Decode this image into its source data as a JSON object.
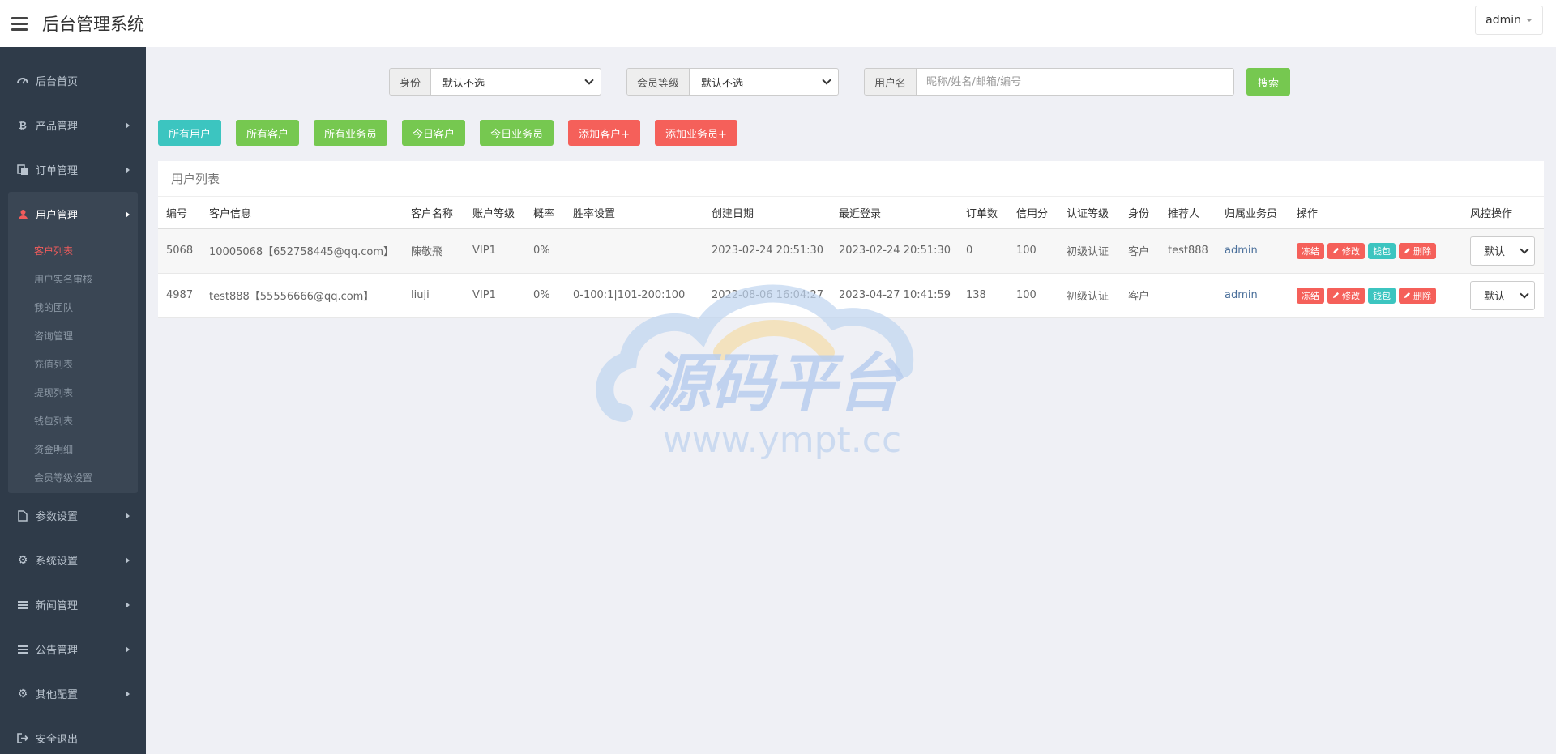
{
  "header": {
    "title": "后台管理系统",
    "user": "admin"
  },
  "sidebar": {
    "items_top": [
      {
        "label": "后台首页",
        "icon": "dashboard-icon"
      },
      {
        "label": "产品管理",
        "icon": "bitcoin-icon"
      },
      {
        "label": "订单管理",
        "icon": "copy-icon"
      }
    ],
    "group": {
      "label": "用户管理",
      "icon": "user-icon",
      "subs": [
        "客户列表",
        "用户实名审核",
        "我的团队",
        "咨询管理",
        "充值列表",
        "提现列表",
        "钱包列表",
        "资金明细",
        "会员等级设置"
      ]
    },
    "items_bottom": [
      {
        "label": "参数设置",
        "icon": "file-icon"
      },
      {
        "label": "系统设置",
        "icon": "cogs-icon"
      },
      {
        "label": "新闻管理",
        "icon": "list-icon"
      },
      {
        "label": "公告管理",
        "icon": "list-icon"
      },
      {
        "label": "其他配置",
        "icon": "gear-icon"
      },
      {
        "label": "安全退出",
        "icon": "sign-out-icon"
      }
    ]
  },
  "filters": {
    "identity": {
      "label": "身份",
      "value": "默认不选"
    },
    "level": {
      "label": "会员等级",
      "value": "默认不选"
    },
    "username": {
      "label": "用户名",
      "placeholder": "昵称/姓名/邮箱/编号"
    },
    "search_label": "搜索"
  },
  "actions": {
    "all_users": "所有用户",
    "all_customers": "所有客户",
    "all_sales": "所有业务员",
    "today_customers": "今日客户",
    "today_sales": "今日业务员",
    "add_customer": "添加客户+",
    "add_sales": "添加业务员+"
  },
  "table": {
    "title": "用户列表",
    "headers": [
      "编号",
      "客户信息",
      "客户名称",
      "账户等级",
      "概率",
      "胜率设置",
      "创建日期",
      "最近登录",
      "订单数",
      "信用分",
      "认证等级",
      "身份",
      "推荐人",
      "归属业务员",
      "操作",
      "风控操作"
    ],
    "ops": {
      "freeze": "冻结",
      "edit": "修改",
      "wallet": "钱包",
      "delete": "删除"
    },
    "rows": [
      {
        "id": "5068",
        "info": "10005068【652758445@qq.com】",
        "name": "陳敬飛",
        "level": "VIP1",
        "prob": "0%",
        "win": "",
        "created": "2023-02-24 20:51:30",
        "last_login": "2023-02-24 20:51:30",
        "orders": "0",
        "credit": "100",
        "auth": "初级认证",
        "role": "客户",
        "referrer": "test888",
        "sales": "admin",
        "risk": "默认"
      },
      {
        "id": "4987",
        "info": "test888【55556666@qq.com】",
        "name": "liuji",
        "level": "VIP1",
        "prob": "0%",
        "win": "0-100:1|101-200:100",
        "created": "2022-08-06 16:04:27",
        "last_login": "2023-04-27 10:41:59",
        "orders": "138",
        "credit": "100",
        "auth": "初级认证",
        "role": "客户",
        "referrer": "",
        "sales": "admin",
        "risk": "默认"
      }
    ]
  },
  "watermark": {
    "title": "源码平台",
    "url": "www.ympt.cc"
  },
  "colors": {
    "sidebar": "#2f3b49",
    "teal": "#3cc5c0",
    "green": "#76c850",
    "red": "#f5605a",
    "active": "#f15c5c"
  }
}
